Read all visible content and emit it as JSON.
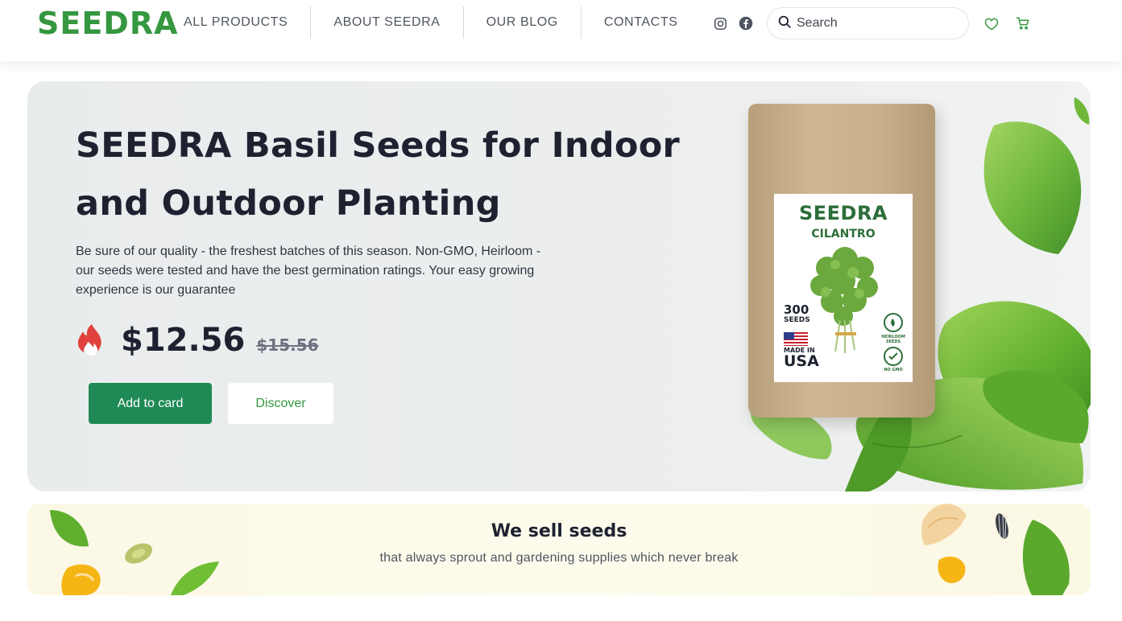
{
  "header": {
    "logo": "SEEDRA",
    "nav": [
      {
        "label": "ALL PRODUCTS"
      },
      {
        "label": "ABOUT SEEDRA"
      },
      {
        "label": "OUR BLOG"
      },
      {
        "label": "CONTACTS"
      }
    ],
    "social": [
      "instagram-icon",
      "facebook-icon"
    ],
    "search": {
      "placeholder": "Search",
      "value": ""
    },
    "icons": [
      "heart-icon",
      "cart-icon"
    ]
  },
  "hero": {
    "title": "SEEDRA Basil Seeds for Indoor and Outdoor Planting",
    "description": "Be sure of our quality - the freshest batches of this season. Non-GMO, Heirloom - our seeds were tested and have the best germination ratings. Your easy growing experience is our guarantee",
    "price": "$12.56",
    "old_price": "$15.56",
    "add_button": "Add to card",
    "discover_button": "Discover",
    "package": {
      "brand": "SEEDRA",
      "variety": "CILANTRO",
      "count": "300",
      "count_unit": "SEEDS",
      "made_in": "MADE IN",
      "country": "USA",
      "badge_heirloom": "HEIRLOOM SEEDS",
      "badge_nongmo": "NO GMO"
    }
  },
  "banner": {
    "title": "We sell seeds",
    "subtitle": "that always sprout and gardening supplies which never break"
  },
  "colors": {
    "brand_green": "#359740",
    "button_green": "#1f8a55",
    "text_dark": "#1e2230",
    "fire_red": "#e0413c"
  }
}
